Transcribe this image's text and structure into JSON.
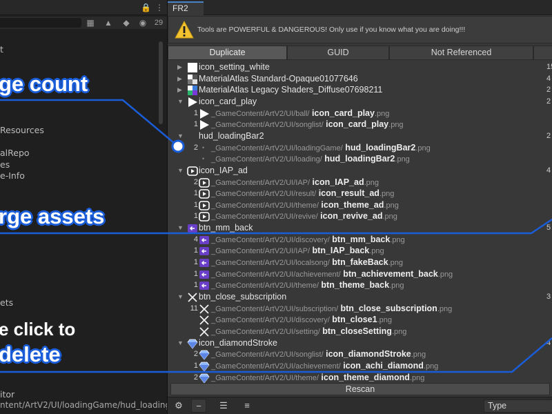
{
  "left_panel": {
    "toolbar_count": "29",
    "lines": [
      "t",
      "Resources",
      "alRepo",
      "es",
      "e-Info",
      "ets",
      "itor"
    ],
    "bottom_path": "ntent/ArtV2/UI/loadingGame/hud_loadingBa"
  },
  "window": {
    "tab_title": "FR2",
    "warning": "Tools are POWERFUL & DANGEROUS! Only use if you know what you are doing!!!"
  },
  "tabs": [
    {
      "label": "Duplicate",
      "active": true
    },
    {
      "label": "GUID",
      "active": false
    },
    {
      "label": "Not Referenced",
      "active": false
    }
  ],
  "rows": [
    {
      "kind": "group",
      "expanded": false,
      "icon": "white-square-icon",
      "label": "icon_setting_white",
      "right": "15"
    },
    {
      "kind": "group",
      "expanded": false,
      "icon": "atlas-mosaic-icon",
      "label": "MaterialAtlas Standard-Opaque01077646",
      "right": "4"
    },
    {
      "kind": "group",
      "expanded": false,
      "icon": "atlas-color-icon",
      "label": "MaterialAtlas Legacy Shaders_Diffuse07698211",
      "right": "2"
    },
    {
      "kind": "group",
      "expanded": true,
      "icon": "play-triangle-icon",
      "label": "icon_card_play",
      "right": "2"
    },
    {
      "kind": "item",
      "count": "1",
      "icon": "play-triangle-icon",
      "path": "_GameContent/ArtV2/UI/ball/",
      "name": "icon_card_play",
      "ext": ".png"
    },
    {
      "kind": "item",
      "count": "1",
      "icon": "play-triangle-icon",
      "path": "_GameContent/ArtV2/UI/songlist/",
      "name": "icon_card_play",
      "ext": ".png"
    },
    {
      "kind": "group",
      "expanded": true,
      "icon": "",
      "label": "hud_loadingBar2",
      "right": "2"
    },
    {
      "kind": "item",
      "count": "2",
      "icon": "",
      "path": "_GameContent/ArtV2/UI/loadingGame/",
      "name": "hud_loadingBar2",
      "ext": ".png"
    },
    {
      "kind": "item",
      "count": "",
      "icon": "",
      "path": "_GameContent/ArtV2/UI/loading/",
      "name": "hud_loadingBar2",
      "ext": ".png"
    },
    {
      "kind": "group",
      "expanded": true,
      "icon": "play-box-icon",
      "label": "icon_IAP_ad",
      "right": "4"
    },
    {
      "kind": "item",
      "count": "2",
      "icon": "play-box-icon",
      "path": "_GameContent/ArtV2/UI/IAP/",
      "name": "icon_IAP_ad",
      "ext": ".png"
    },
    {
      "kind": "item",
      "count": "1",
      "icon": "play-box-icon",
      "path": "_GameContent/ArtV2/UI/result/",
      "name": "icon_result_ad",
      "ext": ".png"
    },
    {
      "kind": "item",
      "count": "1",
      "icon": "play-box-icon",
      "path": "_GameContent/ArtV2/UI/theme/",
      "name": "icon_theme_ad",
      "ext": ".png"
    },
    {
      "kind": "item",
      "count": "1",
      "icon": "play-box-icon",
      "path": "_GameContent/ArtV2/UI/revive/",
      "name": "icon_revive_ad",
      "ext": ".png"
    },
    {
      "kind": "group",
      "expanded": true,
      "icon": "purple-back-icon",
      "label": "btn_mm_back",
      "right": "5"
    },
    {
      "kind": "item",
      "count": "4",
      "icon": "purple-back-icon",
      "path": "_GameContent/ArtV2/UI/discovery/",
      "name": "btn_mm_back",
      "ext": ".png"
    },
    {
      "kind": "item",
      "count": "1",
      "icon": "purple-back-icon",
      "path": "_GameContent/ArtV2/UI/IAP/",
      "name": "btn_IAP_back",
      "ext": ".png"
    },
    {
      "kind": "item",
      "count": "1",
      "icon": "purple-back-icon",
      "path": "_GameContent/ArtV2/UI/localsong/",
      "name": "btn_fakeBack",
      "ext": ".png"
    },
    {
      "kind": "item",
      "count": "1",
      "icon": "purple-back-icon",
      "path": "_GameContent/ArtV2/UI/achievement/",
      "name": "btn_achievement_back",
      "ext": ".png"
    },
    {
      "kind": "item",
      "count": "1",
      "icon": "purple-back-icon",
      "path": "_GameContent/ArtV2/UI/theme/",
      "name": "btn_theme_back",
      "ext": ".png"
    },
    {
      "kind": "group",
      "expanded": true,
      "icon": "cross-icon",
      "label": "btn_close_subscription",
      "right": "3"
    },
    {
      "kind": "item",
      "count": "11",
      "icon": "cross-icon",
      "path": "_GameContent/ArtV2/UI/subscription/",
      "name": "btn_close_subscription",
      "ext": ".png"
    },
    {
      "kind": "item",
      "count": "",
      "icon": "cross-icon",
      "path": "_GameContent/ArtV2/UI/discovery/",
      "name": "btn_close1",
      "ext": ".png"
    },
    {
      "kind": "item",
      "count": "",
      "icon": "cross-icon",
      "path": "_GameContent/ArtV2/UI/setting/",
      "name": "btn_closeSetting",
      "ext": ".png"
    },
    {
      "kind": "group",
      "expanded": true,
      "icon": "diamond-icon",
      "label": "icon_diamondStroke",
      "right": "4"
    },
    {
      "kind": "item",
      "count": "2",
      "icon": "diamond-icon",
      "path": "_GameContent/ArtV2/UI/songlist/",
      "name": "icon_diamondStroke",
      "ext": ".png"
    },
    {
      "kind": "item",
      "count": "1",
      "icon": "diamond-icon",
      "path": "_GameContent/ArtV2/UI/achievement/",
      "name": "icon_achi_diamond",
      "ext": ".png"
    },
    {
      "kind": "item",
      "count": "2",
      "icon": "diamond-icon",
      "path": "_GameContent/ArtV2/UI/theme/",
      "name": "icon_theme_diamond",
      "ext": ".png"
    }
  ],
  "footer": {
    "rescan_label": "Rescan",
    "type_label": "Type"
  },
  "callouts": {
    "usage": "ge count",
    "merge": "rge assets",
    "click": "e click to",
    "delete": "delete"
  },
  "colors": {
    "accent": "#1a5dd9",
    "warning_yellow": "#f2c230"
  }
}
